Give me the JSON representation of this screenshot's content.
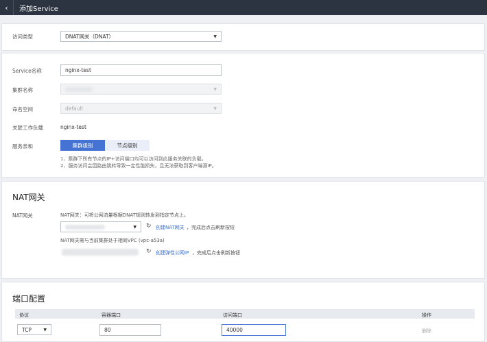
{
  "header": {
    "back_icon": "chevron-left-icon",
    "title": "添加Service"
  },
  "access": {
    "label": "访问类型",
    "value": "DNAT网关（DNAT）"
  },
  "service": {
    "name_label": "Service名称",
    "name_value": "nginx-test",
    "cluster_label": "集群名称",
    "namespace_label": "命名空间",
    "namespace_value": "default",
    "workload_label": "关联工作负载",
    "workload_value": "nginx-test",
    "affinity_label": "服务亲和",
    "affinity_options": [
      "集群级别",
      "节点级别"
    ],
    "affinity_selected": "集群级别",
    "notes": [
      "1、集群下所有节点的IP+访问端口均可以访问到此服务关联的负载。",
      "2、服务访问会因路由跳转导致一定性能损失，且无法获取到客户端源IP。"
    ]
  },
  "nat": {
    "heading": "NAT网关",
    "label": "NAT网关",
    "desc": "NAT网关：可将公网流量根据DNAT规则转发到指定节点上。",
    "create_nat_link": "创建NAT网关",
    "create_nat_hint": "，完成后点击刷新按钮",
    "vpc_text": "NAT网关需与当前集群处于相同VPC (vpc-a53a)",
    "create_eip_link": "创建弹性公网IP",
    "create_eip_hint": "，完成后点击刷新按钮"
  },
  "ports": {
    "heading": "端口配置",
    "columns": [
      "协议",
      "容器端口",
      "访问端口",
      "操作"
    ],
    "rows": [
      {
        "protocol": "TCP",
        "container_port": "80",
        "access_port": "40000",
        "action": "删除"
      }
    ]
  },
  "colors": {
    "topbar": "#2c3441",
    "accent": "#4473d4",
    "link": "#3a6fd0"
  }
}
